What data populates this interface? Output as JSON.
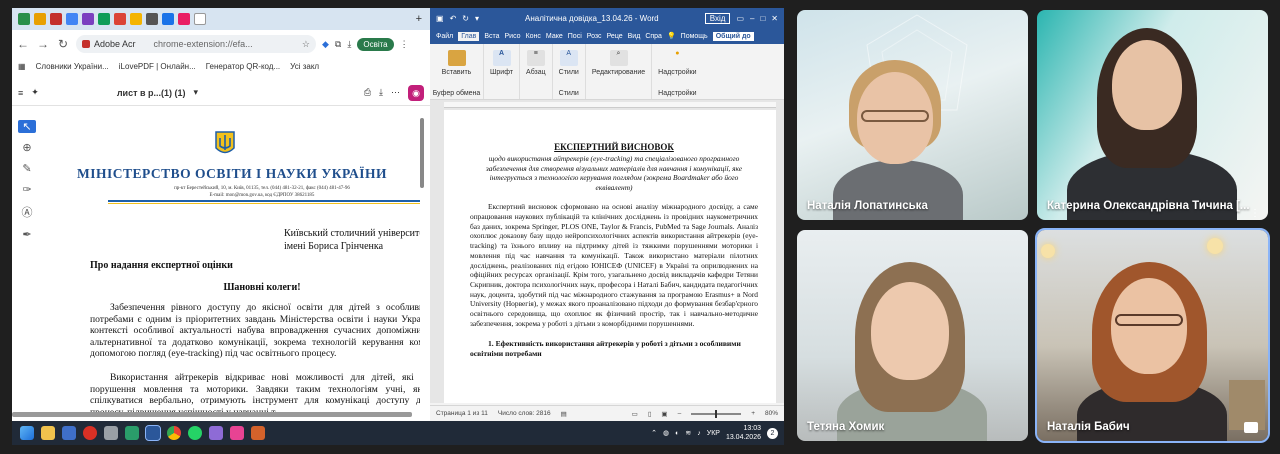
{
  "browser": {
    "omnibox_site": "Adobe Acr",
    "omnibox_url": "chrome-extension://efa...",
    "profile_label": "Освіта",
    "bookmarks": [
      "Словники України...",
      "iLovePDF | Онлайн...",
      "Генератор QR-код...",
      "Усі закл"
    ]
  },
  "pdf": {
    "filename": "лист в р...(1) (1)",
    "ministry": "МІНІСТЕРСТВО ОСВІТИ І НАУКИ УКРАЇНИ",
    "address_line": "пр-кт Берестейський, 10, м. Київ, 01135, тел. (044) 481-32-21, факс (044) 481-47-96",
    "email_line": "E-mail: mon@mon.gov.ua, код ЄДРПОУ 38621185",
    "recipient_1": "Київський столичний університет",
    "recipient_2": "імені Бориса Грінченка",
    "subject": "Про надання експертної оцінки",
    "greeting": "Шановні колеги!",
    "para1": "Забезпечення рівного доступу до якісної освіти для дітей з особливим освітніми потребами є одним із пріоритетних завдань Міністерства освіти і науки України. У цьому контексті особливої актуальності набува впровадження сучасних допоміжних технологій альтернативної та додатково комунікації, зокрема технологій керування комп'ютером за допомогою погляд (eye-tracking) під час освітнього процесу.",
    "para2": "Використання айтрекерів відкриває нові можливості для дітей, які мають тяжкі порушення мовлення та моторики. Завдяки таким технологіям учні, які н можуть спілкуватися вербально, отримують інструмент для комунікаці доступу до освітнього процесу, підвищення успішності у навчанні т"
  },
  "word": {
    "title": "Аналітична довідка_13.04.26 - Word",
    "signin": "Вхід",
    "tabs": [
      "Файл",
      "Глав",
      "Вста",
      "Рисо",
      "Конс",
      "Маке",
      "Посі",
      "Розс",
      "Реце",
      "Вид",
      "Спра",
      "Помощь"
    ],
    "share": "Общий до",
    "ribbon": {
      "paste": "Вставить",
      "font": "Шрифт",
      "paragraph": "Абзац",
      "styles": "Стили",
      "editing": "Редактирование",
      "addins": "Надстройки",
      "clipboard": "Буфер обмена",
      "styles_group": "Стили",
      "addins_group": "Надстройки"
    },
    "doc_title": "ЕКСПЕРТНИЙ ВИСНОВОК",
    "doc_subtitle": "щодо використання айтрекерів (eye-tracking) та спеціалізованого програмного забезпечення для створення візуальних матеріалів для навчання і комунікації, яке інтегрується з технологією керування поглядом (зокрема Boardmaker або його еквівалент)",
    "doc_para": "Експертний висновок сформовано на основі аналізу міжнародного досвіду, а саме опрацювання наукових публікацій та клінічних досліджень із провідних наукометричних баз даних, зокрема Springer, PLOS ONE, Taylor & Francis, PubMed та Sage Journals. Аналіз охоплює доказову базу щодо нейропсихологічних аспектів використання айтрекерів (eye-tracking) та їхнього впливу на підтримку дітей із тяжкими порушеннями моторики і мовлення під час навчання та комунікації. Також використано матеріали пілотних досліджень, реалізованих під егідою ЮНІСЕФ (UNICEF) в Україні та оприлюднених на офіційних ресурсах організації. Крім того, узагальнено досвід викладачів кафедри Тетяни Скрипник, доктора психологічних наук, професора і Наталі Бабич, кандидата педагогічних наук, доцента, здобутий під час міжнародного стажування за програмою Erasmus+ в Nord University (Норвегія), у межах якого проаналізовано підходи до формування безбар'єрного освітнього середовища, що охоплює як фізичний простір, так і навчально-методичне забезпечення, зокрема у роботі з дітьми з коморбідними порушеннями.",
    "doc_heading": "1. Ефективність використання айтрекерів у роботі з дітьми з особливими освітніми потребами",
    "status_page": "Страница 1 из 11",
    "status_words": "Число слов: 2816",
    "zoom": "80%"
  },
  "taskbar": {
    "lang": "УКР",
    "time": "13:03",
    "date": "13.04.2026",
    "notifications": "2"
  },
  "participants": [
    {
      "name": "Наталія Лопатинська"
    },
    {
      "name": "Катерина Олександрівна Тичина [..."
    },
    {
      "name": "Тетяна Хомик"
    },
    {
      "name": "Наталія Бабич"
    }
  ]
}
